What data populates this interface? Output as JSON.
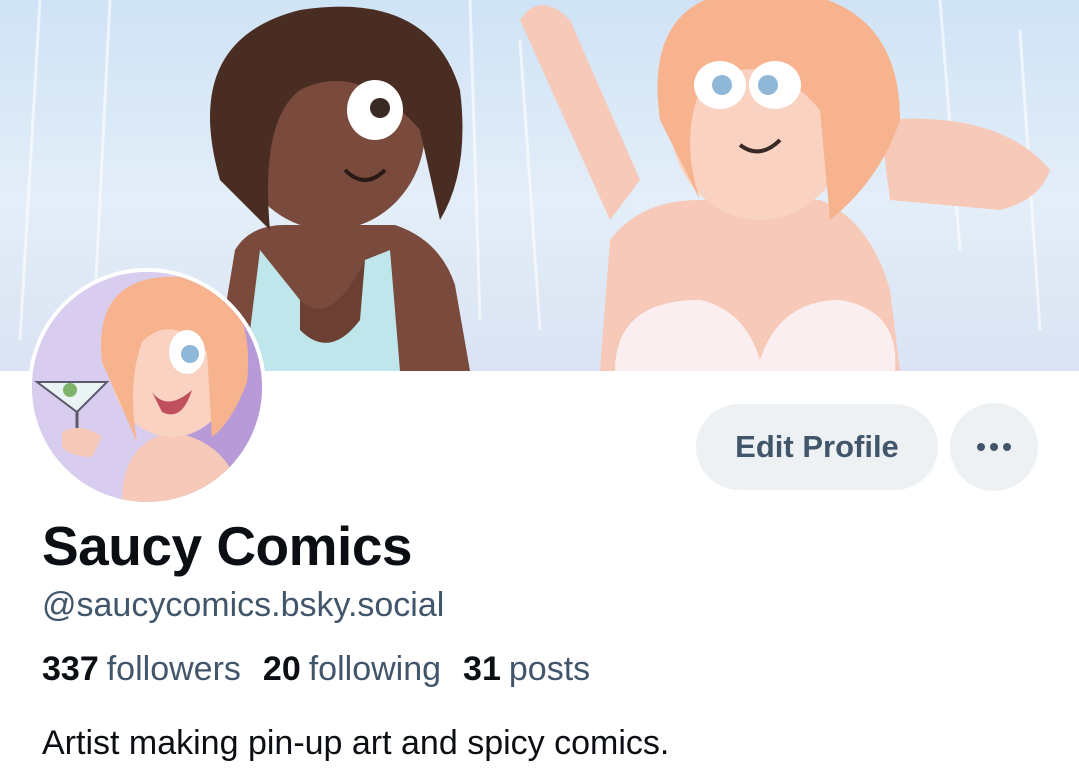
{
  "profile": {
    "display_name": "Saucy Comics",
    "handle": "@saucycomics.bsky.social",
    "bio": "Artist making pin-up art and spicy comics."
  },
  "stats": {
    "followers": {
      "count": "337",
      "label": "followers"
    },
    "following": {
      "count": "20",
      "label": "following"
    },
    "posts": {
      "count": "31",
      "label": "posts"
    }
  },
  "actions": {
    "edit_profile_label": "Edit Profile",
    "more_icon": "ellipsis-icon"
  },
  "images": {
    "banner": "banner-illustration",
    "avatar": "avatar-illustration"
  },
  "colors": {
    "button_bg": "#eef1f4",
    "button_text": "#42566b",
    "secondary_text": "#42566b",
    "primary_text": "#0b0f14"
  }
}
